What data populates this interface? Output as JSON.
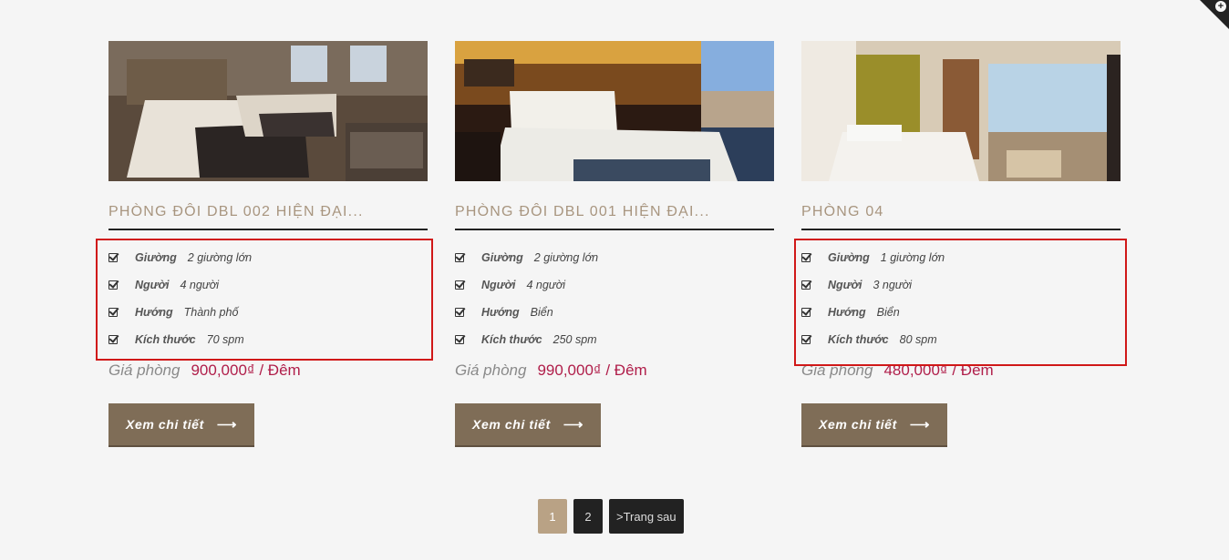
{
  "corner_icon": "plus-circle-icon",
  "rooms": [
    {
      "title": "PHÒNG ĐÔI DBL 002 HIỆN ĐẠI...",
      "features": [
        {
          "label": "Giường",
          "value": "2 giường lớn"
        },
        {
          "label": "Người",
          "value": "4 người"
        },
        {
          "label": "Hướng",
          "value": "Thành phố"
        },
        {
          "label": "Kích thước",
          "value": "70 spm"
        }
      ],
      "price_label": "Giá phòng",
      "price": "900,000₫ / Đêm",
      "button_label": "Xem chi tiết",
      "button_icon": "arrow-right-icon"
    },
    {
      "title": "PHÒNG ĐÔI DBL 001 HIỆN ĐẠI...",
      "features": [
        {
          "label": "Giường",
          "value": "2 giường lớn"
        },
        {
          "label": "Người",
          "value": "4 người"
        },
        {
          "label": "Hướng",
          "value": "Biển"
        },
        {
          "label": "Kích thước",
          "value": "250 spm"
        }
      ],
      "price_label": "Giá phòng",
      "price": "990,000₫ / Đêm",
      "button_label": "Xem chi tiết",
      "button_icon": "arrow-right-icon"
    },
    {
      "title": "PHÒNG 04",
      "features": [
        {
          "label": "Giường",
          "value": "1 giường lớn"
        },
        {
          "label": "Người",
          "value": "3 người"
        },
        {
          "label": "Hướng",
          "value": "Biển"
        },
        {
          "label": "Kích thước",
          "value": "80 spm"
        }
      ],
      "price_label": "Giá phòng",
      "price": "480,000₫ / Đêm",
      "button_label": "Xem chi tiết",
      "button_icon": "arrow-right-icon"
    }
  ],
  "pagination": {
    "pages": [
      "1",
      "2"
    ],
    "active_page": "1",
    "next_label": ">Trang sau"
  },
  "colors": {
    "background": "#f5f5f5",
    "title": "#a8957f",
    "price": "#b01e4a",
    "button": "#7f6d57",
    "highlight": "#d01818",
    "page_active": "#b9a285",
    "page_inactive": "#222222"
  }
}
